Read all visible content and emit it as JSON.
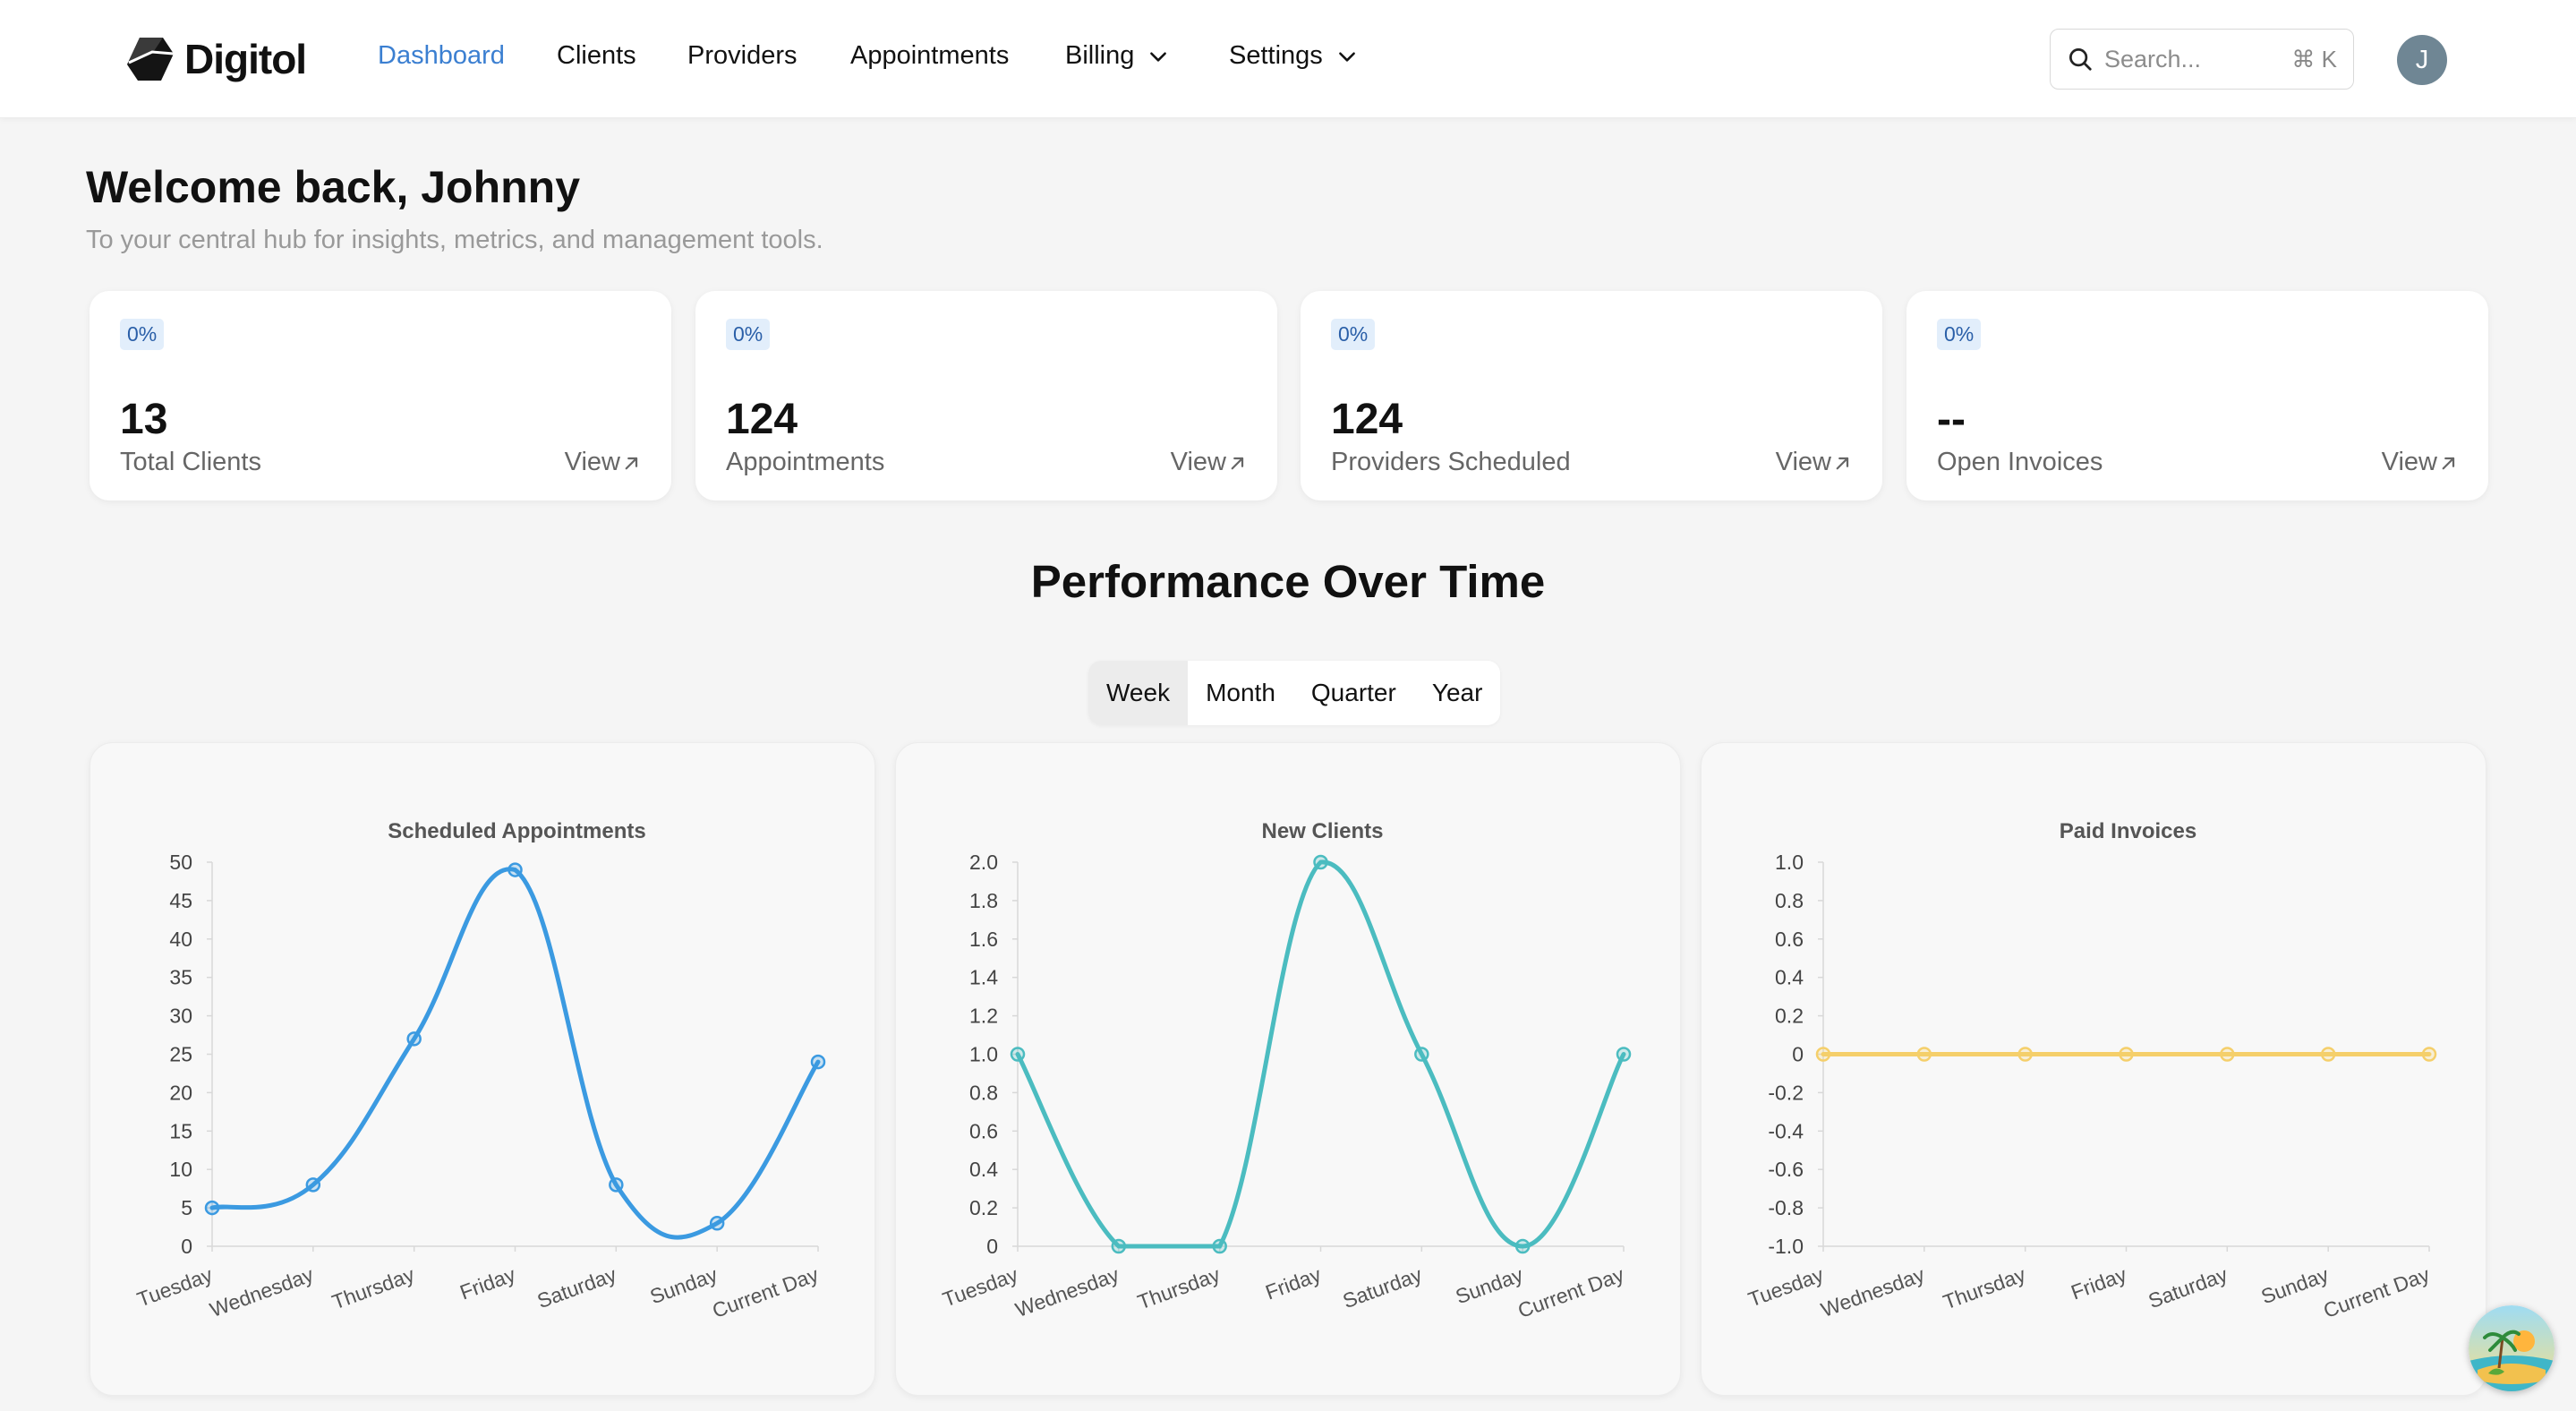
{
  "brand": {
    "name": "Digitol"
  },
  "nav": {
    "items": [
      {
        "label": "Dashboard",
        "active": true,
        "dropdown": false
      },
      {
        "label": "Clients",
        "active": false,
        "dropdown": false
      },
      {
        "label": "Providers",
        "active": false,
        "dropdown": false
      },
      {
        "label": "Appointments",
        "active": false,
        "dropdown": false
      },
      {
        "label": "Billing",
        "active": false,
        "dropdown": true
      },
      {
        "label": "Settings",
        "active": false,
        "dropdown": true
      }
    ],
    "search": {
      "placeholder": "Search...",
      "shortcut": "⌘ K"
    },
    "avatar_initial": "J"
  },
  "welcome": {
    "title": "Welcome back, Johnny",
    "subtitle": "To your central hub for insights, metrics, and management tools."
  },
  "stats": [
    {
      "badge": "0%",
      "value": "13",
      "label": "Total Clients",
      "link": "View"
    },
    {
      "badge": "0%",
      "value": "124",
      "label": "Appointments",
      "link": "View"
    },
    {
      "badge": "0%",
      "value": "124",
      "label": "Providers Scheduled",
      "link": "View"
    },
    {
      "badge": "0%",
      "value": "--",
      "label": "Open Invoices",
      "link": "View"
    }
  ],
  "performance": {
    "title": "Performance Over Time",
    "periods": [
      {
        "label": "Week",
        "active": true
      },
      {
        "label": "Month",
        "active": false
      },
      {
        "label": "Quarter",
        "active": false
      },
      {
        "label": "Year",
        "active": false
      }
    ]
  },
  "colors": {
    "accent": "#3b7fd1",
    "badge_bg": "#e2eefb",
    "line_appointments": "#3b9ae1",
    "line_clients": "#4bbcc0",
    "line_invoices": "#f5cf6a"
  },
  "chart_data": [
    {
      "type": "line",
      "title": "Scheduled Appointments",
      "categories": [
        "Tuesday",
        "Wednesday",
        "Thursday",
        "Friday",
        "Saturday",
        "Sunday",
        "Current Day"
      ],
      "values": [
        5,
        8,
        27,
        49,
        8,
        3,
        24
      ],
      "yticks": [
        0,
        5,
        10,
        15,
        20,
        25,
        30,
        35,
        40,
        45,
        50
      ],
      "ytick_labels": [
        "0",
        "5",
        "10",
        "15",
        "20",
        "25",
        "30",
        "35",
        "40",
        "45",
        "50"
      ],
      "ylim": [
        0,
        50
      ],
      "color": "#3b9ae1",
      "smooth": true
    },
    {
      "type": "line",
      "title": "New Clients",
      "categories": [
        "Tuesday",
        "Wednesday",
        "Thursday",
        "Friday",
        "Saturday",
        "Sunday",
        "Current Day"
      ],
      "values": [
        1,
        0,
        0,
        2,
        1,
        0,
        1
      ],
      "yticks": [
        0,
        0.2,
        0.4,
        0.6,
        0.8,
        1.0,
        1.2,
        1.4,
        1.6,
        1.8,
        2.0
      ],
      "ytick_labels": [
        "0",
        "0.2",
        "0.4",
        "0.6",
        "0.8",
        "1.0",
        "1.2",
        "1.4",
        "1.6",
        "1.8",
        "2.0"
      ],
      "ylim": [
        0,
        2
      ],
      "color": "#4bbcc0",
      "smooth": true
    },
    {
      "type": "line",
      "title": "Paid Invoices",
      "categories": [
        "Tuesday",
        "Wednesday",
        "Thursday",
        "Friday",
        "Saturday",
        "Sunday",
        "Current Day"
      ],
      "values": [
        0,
        0,
        0,
        0,
        0,
        0,
        0
      ],
      "yticks": [
        -1,
        -0.8,
        -0.6,
        -0.4,
        -0.2,
        0,
        0.2,
        0.4,
        0.6,
        0.8,
        1.0
      ],
      "ytick_labels": [
        "-1.0",
        "-0.8",
        "-0.6",
        "-0.4",
        "-0.2",
        "0",
        "0.2",
        "0.4",
        "0.6",
        "0.8",
        "1.0"
      ],
      "ylim": [
        -1,
        1
      ],
      "color": "#f5cf6a",
      "smooth": true
    }
  ]
}
